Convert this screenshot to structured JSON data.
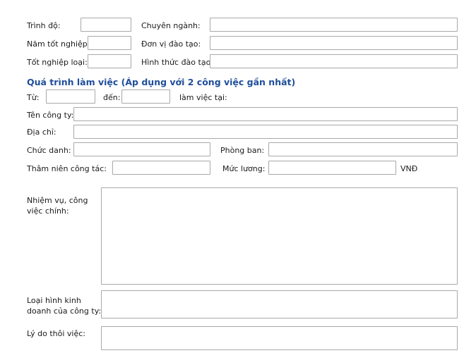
{
  "education": {
    "level_label": "Trình độ:",
    "level_value": "",
    "major_label": "Chuyên ngành:",
    "major_value": "",
    "graduation_year_label": "Năm tốt nghiệp:",
    "graduation_year_value": "",
    "institution_label": "Đơn vị đào tạo:",
    "institution_value": "",
    "graduation_rank_label": "Tốt nghiệp loại:",
    "graduation_rank_value": "",
    "training_type_label": "Hình thức đào tạo:",
    "training_type_value": ""
  },
  "work_history": {
    "heading": "Quá trình làm việc (Áp dụng với 2 công việc gần nhất)",
    "from_label": "Từ:",
    "from_value": "",
    "to_label": "đến:",
    "to_value": "",
    "work_at_label": "làm việc tại:",
    "company_name_label": "Tên công ty:",
    "company_name_value": "",
    "address_label": "Địa chỉ:",
    "address_value": "",
    "position_label": "Chức danh:",
    "position_value": "",
    "department_label": "Phòng ban:",
    "department_value": "",
    "seniority_label": "Thâm niên công tác:",
    "seniority_value": "",
    "salary_label": "Mức lương:",
    "salary_value": "",
    "currency_label": "VNĐ",
    "duties_label": "Nhiệm vụ, công việc chính:",
    "duties_value": "",
    "business_type_label": "Loại hình kinh doanh của công ty:",
    "business_type_value": "",
    "leave_reason_label": "Lý do thôi việc:",
    "leave_reason_value": ""
  }
}
